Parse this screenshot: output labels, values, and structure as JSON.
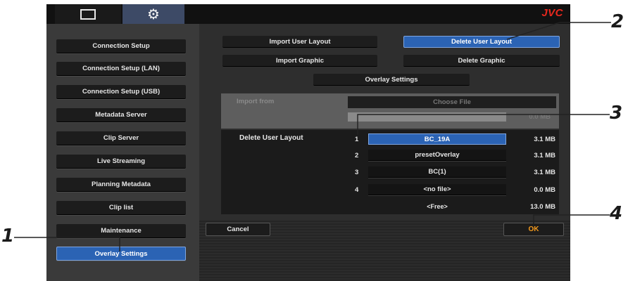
{
  "header": {
    "logo": "JVC",
    "tabs": [
      {
        "icon": "monitor-icon"
      },
      {
        "icon": "gear-icon"
      }
    ]
  },
  "sidebar": {
    "items": [
      {
        "label": "Connection Setup"
      },
      {
        "label": "Connection Setup (LAN)"
      },
      {
        "label": "Connection Setup (USB)"
      },
      {
        "label": "Metadata Server"
      },
      {
        "label": "Clip Server"
      },
      {
        "label": "Live Streaming"
      },
      {
        "label": "Planning Metadata"
      },
      {
        "label": "Clip list"
      },
      {
        "label": "Maintenance"
      },
      {
        "label": "Overlay Settings",
        "active": true
      }
    ]
  },
  "actions": {
    "import_user_layout": "Import User Layout",
    "delete_user_layout": "Delete User Layout",
    "import_graphic": "Import Graphic",
    "delete_graphic": "Delete Graphic",
    "overlay_settings": "Overlay Settings"
  },
  "import_panel": {
    "label": "Import from",
    "choose_file": "Choose File",
    "size": "0.0 MB"
  },
  "delete_panel": {
    "label": "Delete User Layout",
    "files": [
      {
        "num": "1",
        "name": "BC_19A",
        "size": "3.1 MB"
      },
      {
        "num": "2",
        "name": "presetOverlay",
        "size": "3.1 MB"
      },
      {
        "num": "3",
        "name": "BC(1)",
        "size": "3.1 MB"
      },
      {
        "num": "4",
        "name": "<no file>",
        "size": "0.0 MB"
      }
    ],
    "free_label": "<Free>",
    "free_size": "13.0 MB"
  },
  "footer": {
    "cancel": "Cancel",
    "ok": "OK"
  },
  "callouts": {
    "c1": "1",
    "c2": "2",
    "c3": "3",
    "c4": "4"
  },
  "colors": {
    "accent": "#2b63b4",
    "logo": "#e8281e",
    "ok": "#f39a1d"
  }
}
